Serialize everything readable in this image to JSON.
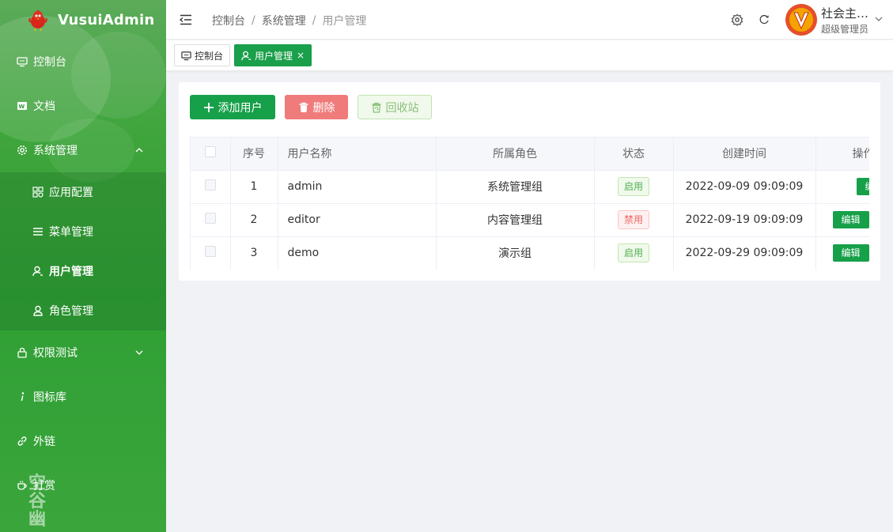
{
  "app": {
    "logo_text": "VusuiAdmin",
    "watermark": "空谷幽"
  },
  "sidebar": {
    "items": [
      {
        "label": "控制台",
        "icon": "monitor-icon"
      },
      {
        "label": "文档",
        "icon": "word-doc-icon"
      },
      {
        "label": "系统管理",
        "icon": "gear-icon",
        "expanded": true
      },
      {
        "label": "权限测试",
        "icon": "lock-icon"
      },
      {
        "label": "图标库",
        "icon": "info-icon"
      },
      {
        "label": "外链",
        "icon": "link-icon"
      },
      {
        "label": "打赏",
        "icon": "coffee-icon"
      }
    ],
    "subitems": [
      {
        "label": "应用配置",
        "icon": "apps-icon"
      },
      {
        "label": "菜单管理",
        "icon": "list-icon"
      },
      {
        "label": "用户管理",
        "icon": "user-icon",
        "active": true
      },
      {
        "label": "角色管理",
        "icon": "user-role-icon"
      }
    ]
  },
  "header": {
    "breadcrumb": [
      "控制台",
      "系统管理",
      "用户管理"
    ],
    "separator": "/",
    "user_name": "社会主…",
    "user_role": "超级管理员"
  },
  "tabs": [
    {
      "label": "控制台",
      "active": false
    },
    {
      "label": "用户管理",
      "active": true,
      "close": "×"
    }
  ],
  "toolbar": {
    "add_label": "添加用户",
    "delete_label": "删除",
    "recycle_label": "回收站"
  },
  "table": {
    "columns": [
      "序号",
      "用户名称",
      "所属角色",
      "状态",
      "创建时间",
      "操作"
    ],
    "edit_label": "编辑",
    "rows": [
      {
        "no": "1",
        "name": "admin",
        "role": "系统管理组",
        "status": "启用",
        "status_type": "on",
        "created": "2022-09-09 09:09:09"
      },
      {
        "no": "2",
        "name": "editor",
        "role": "内容管理组",
        "status": "禁用",
        "status_type": "off",
        "created": "2022-09-19 09:09:09"
      },
      {
        "no": "3",
        "name": "demo",
        "role": "演示组",
        "status": "启用",
        "status_type": "on",
        "created": "2022-09-29 09:09:09"
      }
    ]
  },
  "colors": {
    "primary": "#17a04a",
    "danger": "#f07b7b",
    "sidebar": "#2f9f33"
  }
}
